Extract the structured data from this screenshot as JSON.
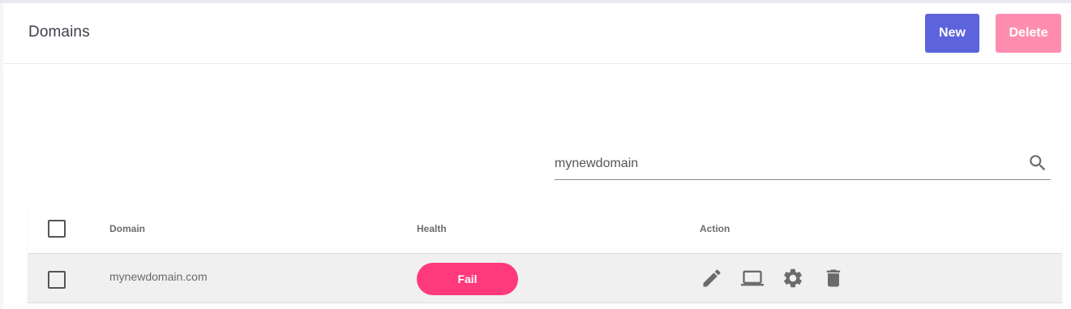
{
  "header": {
    "title": "Domains",
    "new_label": "New",
    "delete_label": "Delete"
  },
  "search": {
    "value": "mynewdomain",
    "icon": "search-icon"
  },
  "table": {
    "columns": [
      "Domain",
      "Health",
      "Action"
    ],
    "rows": [
      {
        "domain": "mynewdomain.com",
        "health": "Fail",
        "actions": [
          "edit-icon",
          "laptop-icon",
          "gear-icon",
          "trash-icon"
        ]
      }
    ]
  },
  "colors": {
    "primary": "#5c63dc",
    "danger": "#ff8db0",
    "fail": "#ff3a7c"
  }
}
